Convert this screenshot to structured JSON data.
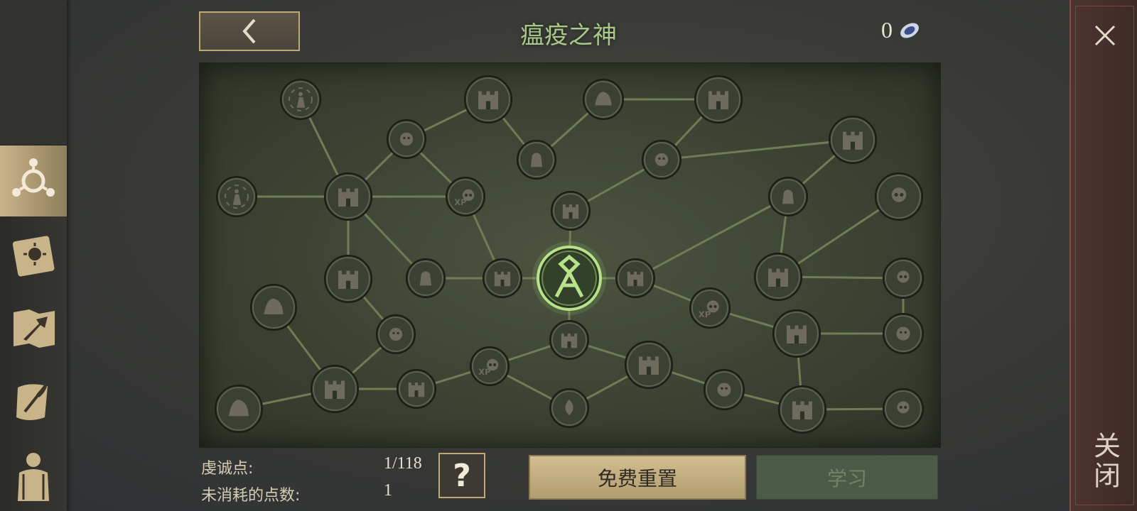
{
  "header": {
    "title": "瘟疫之神",
    "currency_count": "0",
    "currency_icon": "blue-gem-icon"
  },
  "sidebar": {
    "items": [
      {
        "name": "sidebar-item-skills",
        "icon": "skill-tree-icon",
        "active": true
      },
      {
        "name": "sidebar-item-sun-book",
        "icon": "sun-book-icon",
        "active": false
      },
      {
        "name": "sidebar-item-map",
        "icon": "map-arrow-icon",
        "active": false
      },
      {
        "name": "sidebar-item-scroll",
        "icon": "quill-scroll-icon",
        "active": false
      },
      {
        "name": "sidebar-item-character",
        "icon": "character-icon",
        "active": false
      }
    ]
  },
  "tree": {
    "center_node_icon": "plague-rune-icon",
    "node_icons": [
      "tower-icon",
      "skull-icon",
      "xp-skull-icon",
      "figure-icon",
      "stone-icon",
      "drop-icon",
      "face-icon",
      "hand-icon"
    ]
  },
  "footer": {
    "devotion_label": "虔诚点:",
    "devotion_value": "1/118",
    "unspent_label": "未消耗的点数:",
    "unspent_value": "1",
    "help_symbol": "?",
    "reset_label": "免费重置",
    "learn_label": "学习"
  },
  "close": {
    "label": "关闭"
  },
  "colors": {
    "accent_green": "#a8c98a",
    "gold": "#bfa874",
    "close_red": "#8e4b3e"
  }
}
